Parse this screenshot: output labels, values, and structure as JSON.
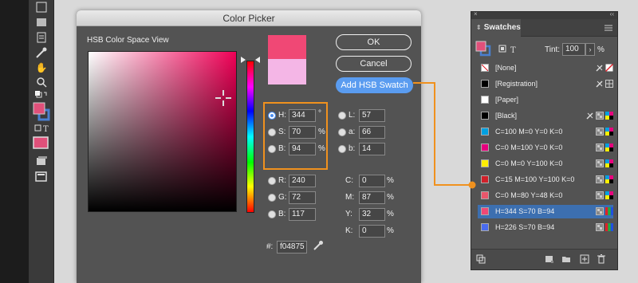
{
  "dialog": {
    "title": "Color Picker",
    "space_heading": "HSB Color Space View",
    "new_color": "#f04875",
    "old_color": "#f4b6e6",
    "ok_label": "OK",
    "cancel_label": "Cancel",
    "add_label": "Add HSB Swatch",
    "hsb": [
      {
        "label": "H:",
        "value": "344",
        "unit": "°",
        "selected": true
      },
      {
        "label": "S:",
        "value": "70",
        "unit": "%",
        "selected": false
      },
      {
        "label": "B:",
        "value": "94",
        "unit": "%",
        "selected": false
      }
    ],
    "lab": [
      {
        "label": "L:",
        "value": "57"
      },
      {
        "label": "a:",
        "value": "66"
      },
      {
        "label": "b:",
        "value": "14"
      }
    ],
    "rgb": [
      {
        "label": "R:",
        "value": "240"
      },
      {
        "label": "G:",
        "value": "72"
      },
      {
        "label": "B:",
        "value": "117"
      }
    ],
    "cmyk": [
      {
        "label": "C:",
        "value": "0",
        "unit": "%"
      },
      {
        "label": "M:",
        "value": "87",
        "unit": "%"
      },
      {
        "label": "Y:",
        "value": "32",
        "unit": "%"
      },
      {
        "label": "K:",
        "value": "0",
        "unit": "%"
      }
    ],
    "hex_label": "#:",
    "hex_value": "f04875"
  },
  "swatches": {
    "tab_title": "Swatches",
    "tint_label": "Tint:",
    "tint_value": "100",
    "tint_unit": "%",
    "fill_color": "#e0507a",
    "highlight_color": "#f0911e",
    "rows": [
      {
        "name": "[None]",
        "color": "none",
        "icons": [
          "no-edit-icon",
          "none-icon"
        ]
      },
      {
        "name": "[Registration]",
        "color": "#000000",
        "icons": [
          "no-edit-icon",
          "registration-icon"
        ]
      },
      {
        "name": "[Paper]",
        "color": "#ffffff",
        "icons": []
      },
      {
        "name": "[Black]",
        "color": "#000000",
        "icons": [
          "no-edit-icon",
          "process-icon",
          "cmyk-icon"
        ]
      },
      {
        "name": "C=100 M=0 Y=0 K=0",
        "color": "#00a0e0",
        "icons": [
          "process-icon",
          "cmyk-icon"
        ]
      },
      {
        "name": "C=0 M=100 Y=0 K=0",
        "color": "#e6007e",
        "icons": [
          "process-icon",
          "cmyk-icon"
        ]
      },
      {
        "name": "C=0 M=0 Y=100 K=0",
        "color": "#ffee00",
        "icons": [
          "process-icon",
          "cmyk-icon"
        ]
      },
      {
        "name": "C=15 M=100 Y=100 K=0",
        "color": "#d0202a",
        "icons": [
          "process-icon",
          "cmyk-icon"
        ]
      },
      {
        "name": "C=0 M=80 Y=48 K=0",
        "color": "#e8566b",
        "icons": [
          "process-icon",
          "cmyk-icon"
        ]
      },
      {
        "name": "H=344 S=70 B=94",
        "color": "#f04875",
        "icons": [
          "process-icon",
          "rgb-icon"
        ],
        "selected": true
      },
      {
        "name": "H=226 S=70 B=94",
        "color": "#4a6cf0",
        "icons": [
          "process-icon",
          "rgb-icon"
        ]
      }
    ]
  }
}
